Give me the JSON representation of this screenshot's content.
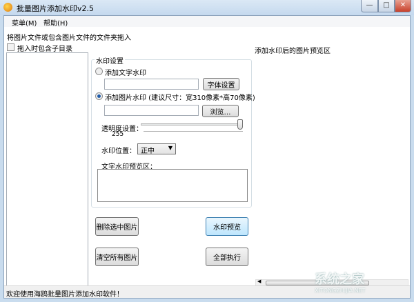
{
  "window": {
    "title": "批量图片添加水印v2.5",
    "minimize": "—",
    "maximize": "□",
    "close": "✕"
  },
  "menu": [
    {
      "label": "菜单(M)"
    },
    {
      "label": "帮助(H)"
    }
  ],
  "left": {
    "drop_hint": "将图片文件或包含图片文件的文件夹拖入",
    "include_subdirs": "拖入时包含子目录",
    "include_subdirs_checked": false
  },
  "settings": {
    "group_title": "水印设置",
    "text_watermark": "添加文字水印",
    "text_watermark_selected": false,
    "text_value": "",
    "font_button": "字体设置",
    "image_watermark": "添加图片水印 (建议尺寸：宽310像素*高70像素)",
    "image_watermark_selected": true,
    "image_path": "",
    "browse_button": "浏览…",
    "opacity_label": "透明度设置：",
    "opacity_value": "255",
    "opacity_max": 255,
    "position_label": "水印位置：",
    "position_value": "正中",
    "text_preview_label": "文字水印预览区："
  },
  "buttons": {
    "delete_selected": "删除选中图片",
    "preview": "水印预览",
    "clear_all": "清空所有图片",
    "run_all": "全部执行"
  },
  "right": {
    "preview_label": "添加水印后的图片预览区"
  },
  "status": {
    "text": "欢迎使用海鸥批量图片添加水印软件！"
  },
  "watermark": {
    "cn": "系统之家",
    "en": "XITONGZHIJIA.NET"
  }
}
